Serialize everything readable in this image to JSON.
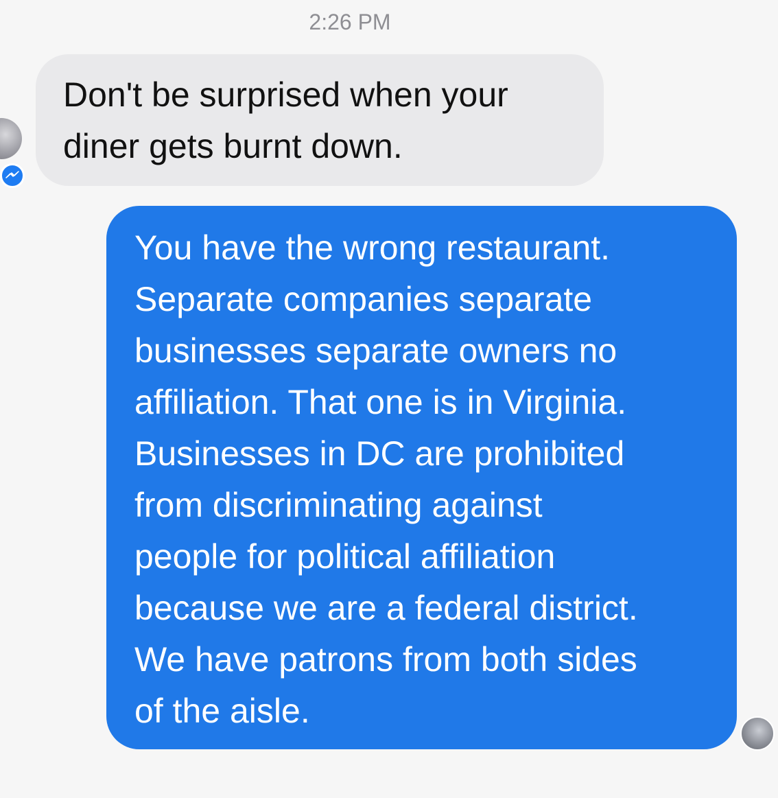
{
  "chat": {
    "timestamp": "2:26 PM",
    "messages": [
      {
        "direction": "received",
        "text": "Don't be surprised when your\ndiner gets burnt down."
      },
      {
        "direction": "sent",
        "text": "You have the wrong restaurant.\nSeparate companies separate\nbusinesses separate owners no\naffiliation. That one is in Virginia.\nBusinesses in DC are prohibited\nfrom discriminating against\npeople for political affiliation\nbecause we are a federal district.\nWe have patrons from both sides\nof the aisle."
      }
    ]
  },
  "icons": {
    "sender_avatar": "avatar-icon",
    "messenger_badge": "messenger-bolt-icon",
    "read_receipt": "avatar-icon"
  },
  "colors": {
    "background": "#f6f6f6",
    "received_bubble": "#e9e9eb",
    "sent_bubble": "#2079e8",
    "messenger_blue": "#1e7cf2",
    "timestamp_text": "#8e8e93"
  }
}
